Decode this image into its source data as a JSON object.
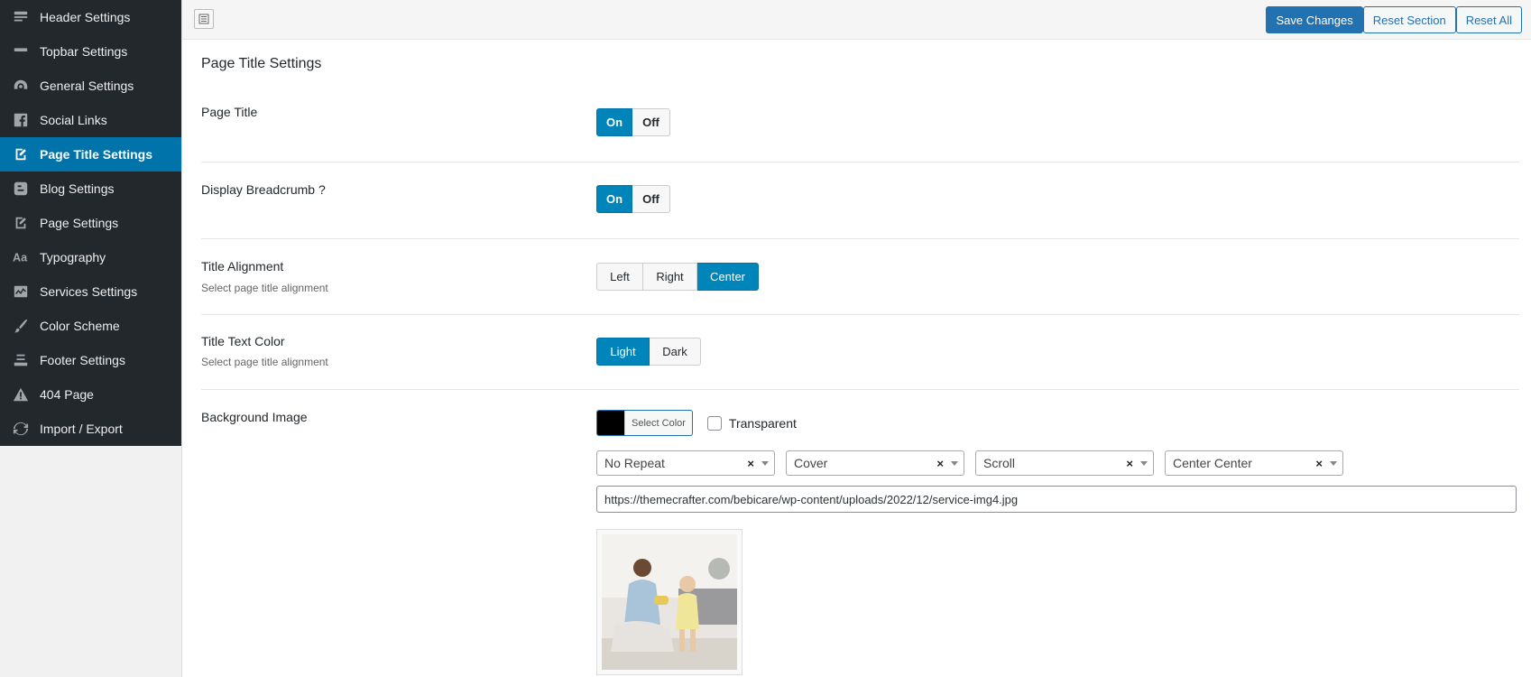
{
  "sidebar": {
    "items": [
      {
        "label": "Header Settings",
        "icon": "header-icon"
      },
      {
        "label": "Topbar Settings",
        "icon": "minus-bar-icon"
      },
      {
        "label": "General Settings",
        "icon": "dashboard-gauge-icon"
      },
      {
        "label": "Social Links",
        "icon": "facebook-icon"
      },
      {
        "label": "Page Title Settings",
        "icon": "edit-page-icon",
        "active": true
      },
      {
        "label": "Blog Settings",
        "icon": "blogger-icon"
      },
      {
        "label": "Page Settings",
        "icon": "edit-page-icon"
      },
      {
        "label": "Typography",
        "icon": "typography-icon"
      },
      {
        "label": "Services Settings",
        "icon": "chart-line-icon"
      },
      {
        "label": "Color Scheme",
        "icon": "brush-icon"
      },
      {
        "label": "Footer Settings",
        "icon": "footer-stack-icon"
      },
      {
        "label": "404 Page",
        "icon": "warning-icon"
      },
      {
        "label": "Import / Export",
        "icon": "refresh-icon"
      }
    ]
  },
  "toolbar": {
    "save_label": "Save Changes",
    "reset_section_label": "Reset Section",
    "reset_all_label": "Reset All"
  },
  "section": {
    "title": "Page Title Settings"
  },
  "fields": {
    "page_title": {
      "label": "Page Title",
      "options": [
        "On",
        "Off"
      ],
      "selected": "On"
    },
    "breadcrumb": {
      "label": "Display Breadcrumb ?",
      "options": [
        "On",
        "Off"
      ],
      "selected": "On"
    },
    "alignment": {
      "label": "Title Alignment",
      "desc": "Select page title alignment",
      "options": [
        "Left",
        "Right",
        "Center"
      ],
      "selected": "Center"
    },
    "text_color": {
      "label": "Title Text Color",
      "desc": "Select page title alignment",
      "options": [
        "Light",
        "Dark"
      ],
      "selected": "Light"
    },
    "background": {
      "label": "Background Image",
      "color_button": "Select Color",
      "color_value": "#000000",
      "transparent_label": "Transparent",
      "repeat": "No Repeat",
      "size": "Cover",
      "attachment": "Scroll",
      "position": "Center Center",
      "clear_symbol": "×",
      "url": "https://themecrafter.com/bebicare/wp-content/uploads/2022/12/service-img4.jpg"
    }
  },
  "colors": {
    "sidebar_bg": "#23282d",
    "active_bg": "#0073aa",
    "accent": "#0085ba",
    "primary_button": "#2271b1"
  }
}
